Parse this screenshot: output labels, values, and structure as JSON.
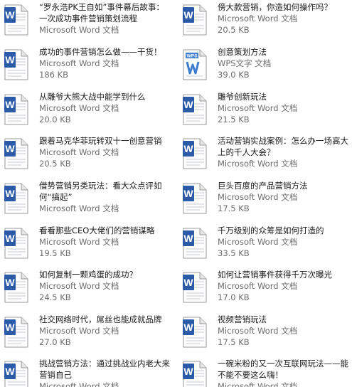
{
  "files": [
    {
      "name": "“罗永浩PK王自如”事件幕后故事：一次成功事件营销策划流程",
      "type": "Microsoft Word 文档",
      "size": "",
      "icon": "word-icon"
    },
    {
      "name": "傍大款营销，你造如何操作吗？",
      "type": "Microsoft Word 文档",
      "size": "20.5 KB",
      "icon": "word-icon"
    },
    {
      "name": "成功的事件营销怎么做——干货！",
      "type": "Microsoft Word 文档",
      "size": "186 KB",
      "icon": "word-icon"
    },
    {
      "name": "创意策划方法",
      "type": "WPS文字 文档",
      "size": "39.0 KB",
      "icon": "wps-icon"
    },
    {
      "name": "从雕爷大熊大战中能学到什么",
      "type": "Microsoft Word 文档",
      "size": "20.0 KB",
      "icon": "word-icon"
    },
    {
      "name": "雕爷创新玩法",
      "type": "Microsoft Word 文档",
      "size": "21.5 KB",
      "icon": "word-icon"
    },
    {
      "name": "跟着马克华菲玩转双十一创意营销",
      "type": "Microsoft Word 文档",
      "size": "20.5 KB",
      "icon": "word-icon"
    },
    {
      "name": "活动营销实战案例：怎么办一场高大上的千人大会？",
      "type": "Microsoft Word 文档",
      "size": "",
      "icon": "word-icon"
    },
    {
      "name": "借势营销另类玩法：看大众点评如何“搞起”",
      "type": "Microsoft Word 文档",
      "size": "",
      "icon": "word-icon"
    },
    {
      "name": "巨头百度的产品营销方法",
      "type": "Microsoft Word 文档",
      "size": "17.5 KB",
      "icon": "word-icon"
    },
    {
      "name": "看看那些CEO大佬们的营销谋略",
      "type": "Microsoft Word 文档",
      "size": "19.5 KB",
      "icon": "word-icon"
    },
    {
      "name": "千万级别的众筹是如何打造的",
      "type": "Microsoft Word 文档",
      "size": "33.5 KB",
      "icon": "word-icon"
    },
    {
      "name": "如何复制一颗鸡蛋的成功？",
      "type": "Microsoft Word 文档",
      "size": "24.5 KB",
      "icon": "word-icon"
    },
    {
      "name": "如何让营销事件获得千万次曝光",
      "type": "Microsoft Word 文档",
      "size": "17.0 KB",
      "icon": "word-icon"
    },
    {
      "name": "社交网络时代，屌丝也能成就品牌",
      "type": "Microsoft Word 文档",
      "size": "27.0 KB",
      "icon": "word-icon"
    },
    {
      "name": "视频营销玩法",
      "type": "Microsoft Word 文档",
      "size": "17.5 KB",
      "icon": "word-icon"
    },
    {
      "name": "挑战营销方法：通过挑战业内老大来营销自己",
      "type": "Microsoft Word 文档",
      "size": "",
      "icon": "word-icon"
    },
    {
      "name": "一碗米粉的又一次互联网玩法——能不能不要这么嗨！",
      "type": "Microsoft Word 文档",
      "size": "",
      "icon": "word-icon"
    }
  ],
  "colors": {
    "word_icon_blue": "#2b5aa8",
    "wps_icon_blue": "#3f7fd0",
    "name_text": "#1a1a1a",
    "meta_text": "#6d6d6d"
  }
}
